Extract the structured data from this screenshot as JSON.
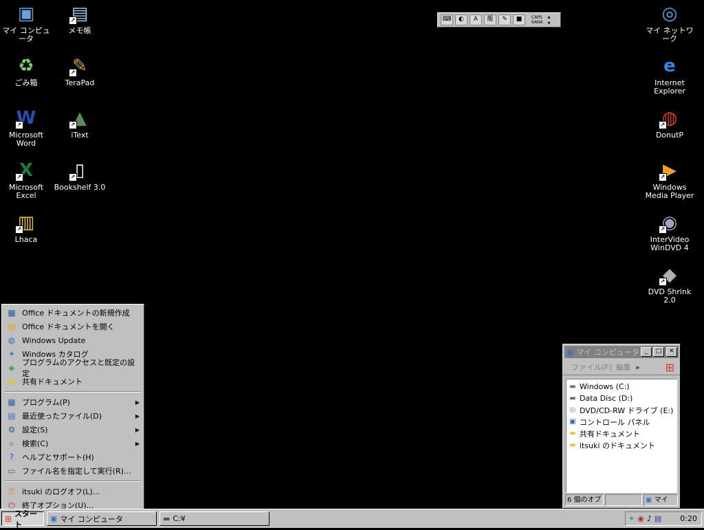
{
  "desktop_left": [
    {
      "label": "マイ コンピュータ",
      "icon": "my-computer-icon",
      "shortcut": false
    },
    {
      "label": "メモ帳",
      "icon": "notepad-icon",
      "shortcut": true
    },
    {
      "label": "ごみ箱",
      "icon": "recycle-bin-icon",
      "shortcut": false
    },
    {
      "label": "TeraPad",
      "icon": "terapad-icon",
      "shortcut": true
    },
    {
      "label": "Microsoft\nWord",
      "icon": "word-icon",
      "shortcut": true
    },
    {
      "label": "iText",
      "icon": "itext-icon",
      "shortcut": true
    },
    {
      "label": "Microsoft\nExcel",
      "icon": "excel-icon",
      "shortcut": true
    },
    {
      "label": "Bookshelf 3.0",
      "icon": "bookshelf-icon",
      "shortcut": true
    },
    {
      "label": "Lhaca",
      "icon": "lhaca-icon",
      "shortcut": true
    }
  ],
  "desktop_right": [
    {
      "label": "マイ ネットワーク",
      "icon": "my-network-icon",
      "shortcut": false
    },
    {
      "label": "Internet\nExplorer",
      "icon": "internet-explorer-icon",
      "shortcut": false
    },
    {
      "label": "DonutP",
      "icon": "donutp-icon",
      "shortcut": true
    },
    {
      "label": "Windows\nMedia Player",
      "icon": "media-player-icon",
      "shortcut": true
    },
    {
      "label": "InterVideo\nWinDVD 4",
      "icon": "windvd-icon",
      "shortcut": true
    },
    {
      "label": "DVD Shrink\n2.0",
      "icon": "dvd-shrink-icon",
      "shortcut": true
    }
  ],
  "ime_bar": {
    "mode": "A",
    "kanji": "般",
    "caps": "CAPS",
    "kana": "KANA"
  },
  "start_menu": {
    "top_items": [
      {
        "label": "Office ドキュメントの新規作成",
        "icon": "office-new-icon"
      },
      {
        "label": "Office ドキュメントを開く",
        "icon": "office-open-icon"
      },
      {
        "label": "Windows Update",
        "icon": "windows-update-icon"
      },
      {
        "label": "Windows カタログ",
        "icon": "windows-catalog-icon"
      },
      {
        "label": "プログラムのアクセスと既定の設定",
        "icon": "program-defaults-icon"
      },
      {
        "label": "共有ドキュメント",
        "icon": "folder-icon"
      }
    ],
    "main_items": [
      {
        "label": "プログラム(P)",
        "icon": "programs-icon",
        "submenu": true
      },
      {
        "label": "最近使ったファイル(D)",
        "icon": "recent-files-icon",
        "submenu": true
      },
      {
        "label": "設定(S)",
        "icon": "settings-icon",
        "submenu": true
      },
      {
        "label": "検索(C)",
        "icon": "search-icon",
        "submenu": true
      },
      {
        "label": "ヘルプとサポート(H)",
        "icon": "help-icon",
        "submenu": false
      },
      {
        "label": "ファイル名を指定して実行(R)...",
        "icon": "run-icon",
        "submenu": false
      }
    ],
    "bottom_items": [
      {
        "label": "itsuki のログオフ(L)...",
        "icon": "logoff-icon"
      },
      {
        "label": "終了オプション(U)...",
        "icon": "shutdown-icon"
      }
    ]
  },
  "explorer_window": {
    "title": "マイ コンピュータ",
    "menu_file": "ファイル(F)",
    "menu_edit": "編集",
    "menu_more": "»",
    "items": [
      {
        "label": "Windows (C:)",
        "icon": "hard-drive-icon"
      },
      {
        "label": "Data Disc (D:)",
        "icon": "hard-drive-icon"
      },
      {
        "label": "DVD/CD-RW ドライブ (E:)",
        "icon": "cd-drive-icon"
      },
      {
        "label": "コントロール パネル",
        "icon": "control-panel-icon"
      },
      {
        "label": "共有ドキュメント",
        "icon": "folder-icon"
      },
      {
        "label": "itsuki のドキュメント",
        "icon": "folder-icon"
      }
    ],
    "status_count": "6 個のオブ",
    "status_location": "マイ"
  },
  "taskbar": {
    "start_label": "スタート",
    "tasks": [
      {
        "label": "マイ コンピュータ",
        "icon": "my-computer-icon"
      },
      {
        "label": "C:¥",
        "icon": "hard-drive-icon"
      }
    ],
    "clock": "0:20"
  }
}
